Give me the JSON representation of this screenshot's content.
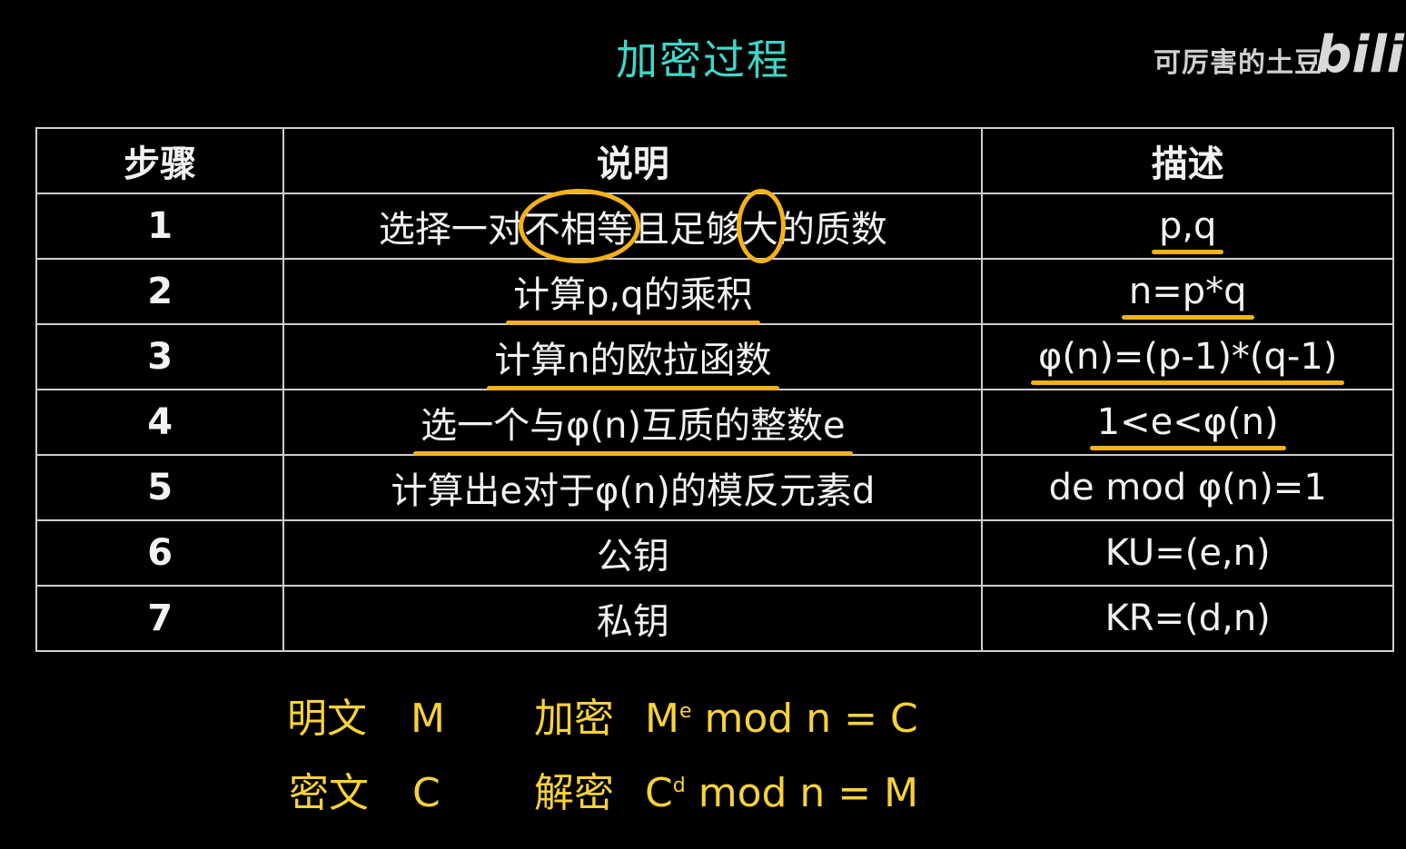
{
  "title": "加密过程",
  "watermark": {
    "text": "可厉害的土豆",
    "logo": "bili"
  },
  "table": {
    "headers": [
      "步骤",
      "说明",
      "描述"
    ],
    "rows": [
      {
        "step": "1",
        "desc_a": "选择一对",
        "desc_b": "不相等",
        "desc_c": "且足够",
        "desc_d": "大",
        "desc_e": "的质数",
        "formula": "p,q"
      },
      {
        "step": "2",
        "desc": "计算p,q的乘积",
        "formula": "n=p*q"
      },
      {
        "step": "3",
        "desc": "计算n的欧拉函数",
        "formula": "φ(n)=(p-1)*(q-1)"
      },
      {
        "step": "4",
        "desc": "选一个与φ(n)互质的整数e",
        "formula": "1<e<φ(n)"
      },
      {
        "step": "5",
        "desc": "计算出e对于φ(n)的模反元素d",
        "formula": "de mod φ(n)=1"
      },
      {
        "step": "6",
        "desc": "公钥",
        "formula": "KU=(e,n)"
      },
      {
        "step": "7",
        "desc": "私钥",
        "formula": "KR=(d,n)"
      }
    ]
  },
  "notes": {
    "plaintext_label": "明文",
    "plaintext_symbol": "M",
    "ciphertext_label": "密文",
    "ciphertext_symbol": "C",
    "encrypt_label": "加密",
    "encrypt_base": "M",
    "encrypt_exp": "e",
    "encrypt_rest": "mod n = C",
    "decrypt_label": "解密",
    "decrypt_base": "C",
    "decrypt_exp": "d",
    "decrypt_rest": "mod n = M"
  },
  "colors": {
    "title": "#3fd6c8",
    "highlight": "#f3b21a",
    "notes": "#f7d23a",
    "background": "#000000"
  }
}
